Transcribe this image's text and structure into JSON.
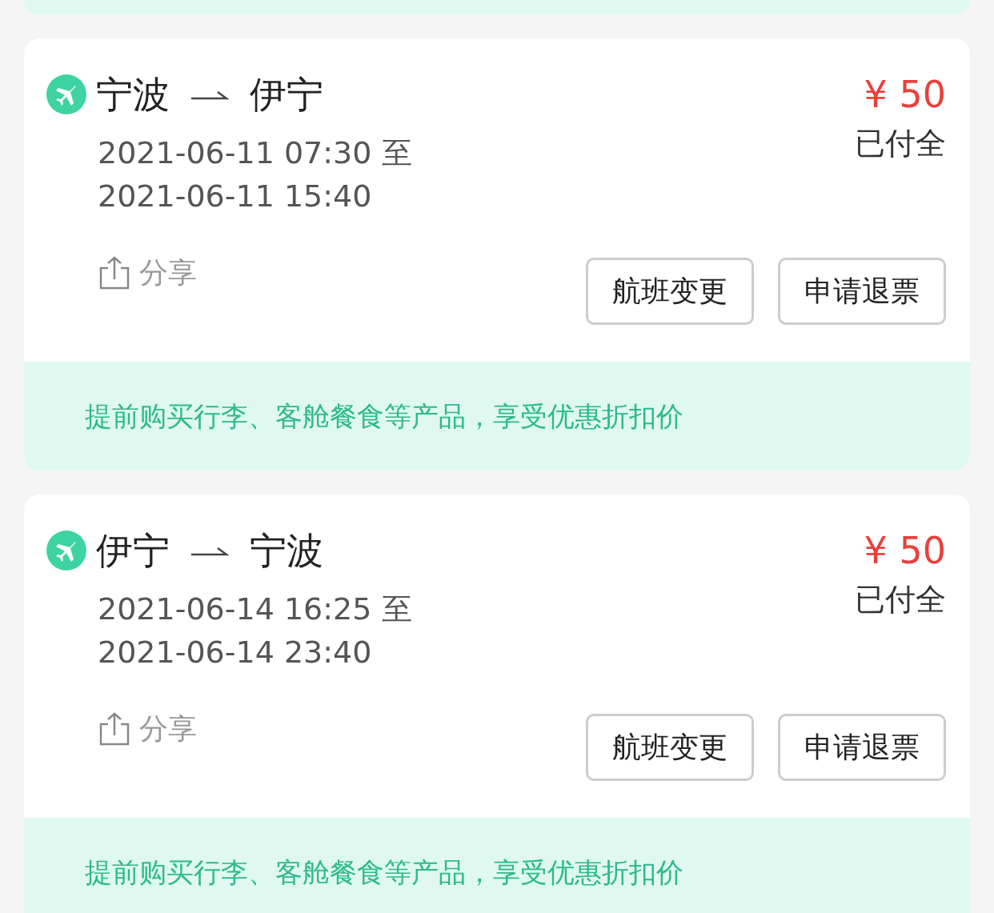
{
  "orders": [
    {
      "from": "宁波",
      "to": "伊宁",
      "price": "¥ 50",
      "status": "已付全",
      "depart": "2021-06-11 07:30 至",
      "arrive": "2021-06-11 15:40",
      "share": "分享",
      "buttons": [
        "航班变更",
        "申请退票"
      ],
      "promo": "提前购买行李、客舱餐食等产品，享受优惠折扣价"
    },
    {
      "from": "伊宁",
      "to": "宁波",
      "price": "¥ 50",
      "status": "已付全",
      "depart": "2021-06-14 16:25 至",
      "arrive": "2021-06-14 23:40",
      "share": "分享",
      "buttons": [
        "航班变更",
        "申请退票"
      ],
      "promo": "提前购买行李、客舱餐食等产品，享受优惠折扣价"
    }
  ]
}
